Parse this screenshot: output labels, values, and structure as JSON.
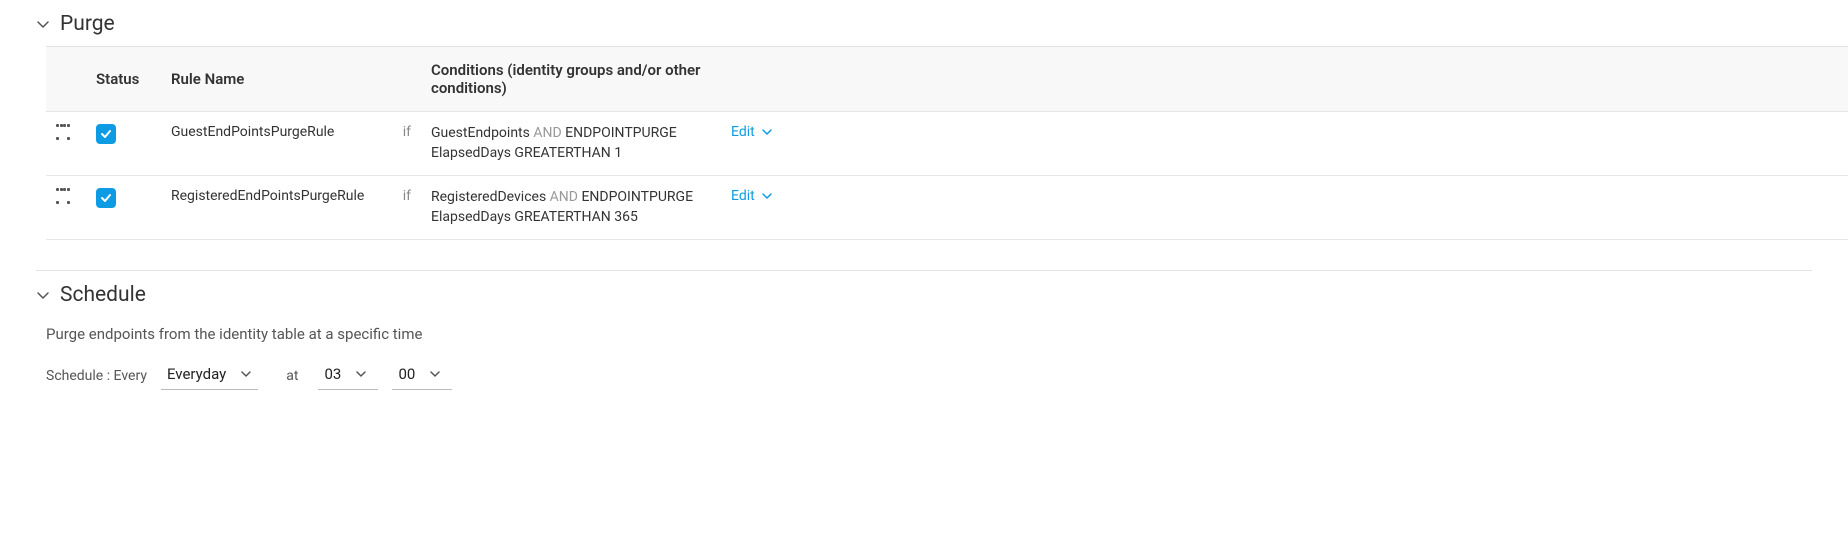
{
  "purge": {
    "title": "Purge",
    "columns": {
      "status": "Status",
      "ruleName": "Rule Name",
      "conditions": "Conditions (identity groups and/or other conditions)"
    },
    "editLabel": "Edit",
    "ifLabel": "if",
    "andLabel": "AND",
    "rules": [
      {
        "name": "GuestEndPointsPurgeRule",
        "checked": true,
        "cond1a": "GuestEndpoints",
        "cond1b": "ENDPOINTPURGE",
        "cond2": "ElapsedDays GREATERTHAN 1"
      },
      {
        "name": "RegisteredEndPointsPurgeRule",
        "checked": true,
        "cond1a": "RegisteredDevices",
        "cond1b": "ENDPOINTPURGE",
        "cond2": "ElapsedDays GREATERTHAN 365"
      }
    ]
  },
  "schedule": {
    "title": "Schedule",
    "description": "Purge endpoints from the identity table at a specific time",
    "prefix": "Schedule : Every",
    "freq": "Everyday",
    "atLabel": "at",
    "hour": "03",
    "minute": "00"
  }
}
